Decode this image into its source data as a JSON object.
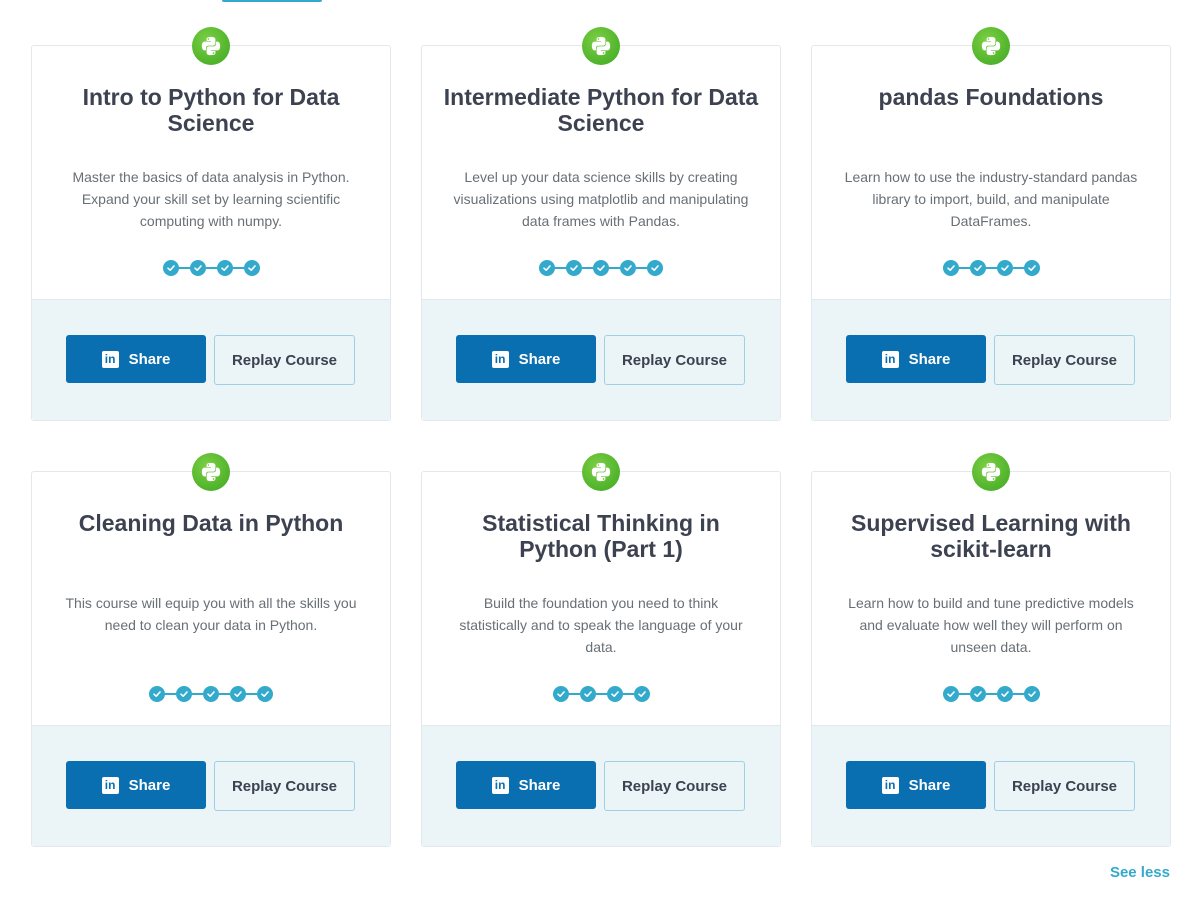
{
  "colors": {
    "accent": "#33aacc",
    "linkedin": "#0a6fb1",
    "python_green": "#4fb32b",
    "footer_bg": "#ebf4f7",
    "title": "#3d4251",
    "desc": "#686f75"
  },
  "courses": [
    {
      "title": "Intro to Python for Data Science",
      "description": "Master the basics of data analysis in Python. Expand your skill set by learning scientific computing with numpy.",
      "chapters_completed": 4,
      "icon": "python-icon",
      "share_label": "Share",
      "replay_label": "Replay Course"
    },
    {
      "title": "Intermediate Python for Data Science",
      "description": "Level up your data science skills by creating visualizations using matplotlib and manipulating data frames with Pandas.",
      "chapters_completed": 5,
      "icon": "python-icon",
      "share_label": "Share",
      "replay_label": "Replay Course"
    },
    {
      "title": "pandas Foundations",
      "description": "Learn how to use the industry-standard pandas library to import, build, and manipulate DataFrames.",
      "chapters_completed": 4,
      "icon": "python-icon",
      "share_label": "Share",
      "replay_label": "Replay Course"
    },
    {
      "title": "Cleaning Data in Python",
      "description": "This course will equip you with all the skills you need to clean your data in Python.",
      "chapters_completed": 5,
      "icon": "python-icon",
      "share_label": "Share",
      "replay_label": "Replay Course"
    },
    {
      "title": "Statistical Thinking in Python (Part 1)",
      "description": "Build the foundation you need to think statistically and to speak the language of your data.",
      "chapters_completed": 4,
      "icon": "python-icon",
      "share_label": "Share",
      "replay_label": "Replay Course"
    },
    {
      "title": "Supervised Learning with scikit-learn",
      "description": "Learn how to build and tune predictive models and evaluate how well they will perform on unseen data.",
      "chapters_completed": 4,
      "icon": "python-icon",
      "share_label": "Share",
      "replay_label": "Replay Course"
    }
  ],
  "see_less_label": "See less"
}
